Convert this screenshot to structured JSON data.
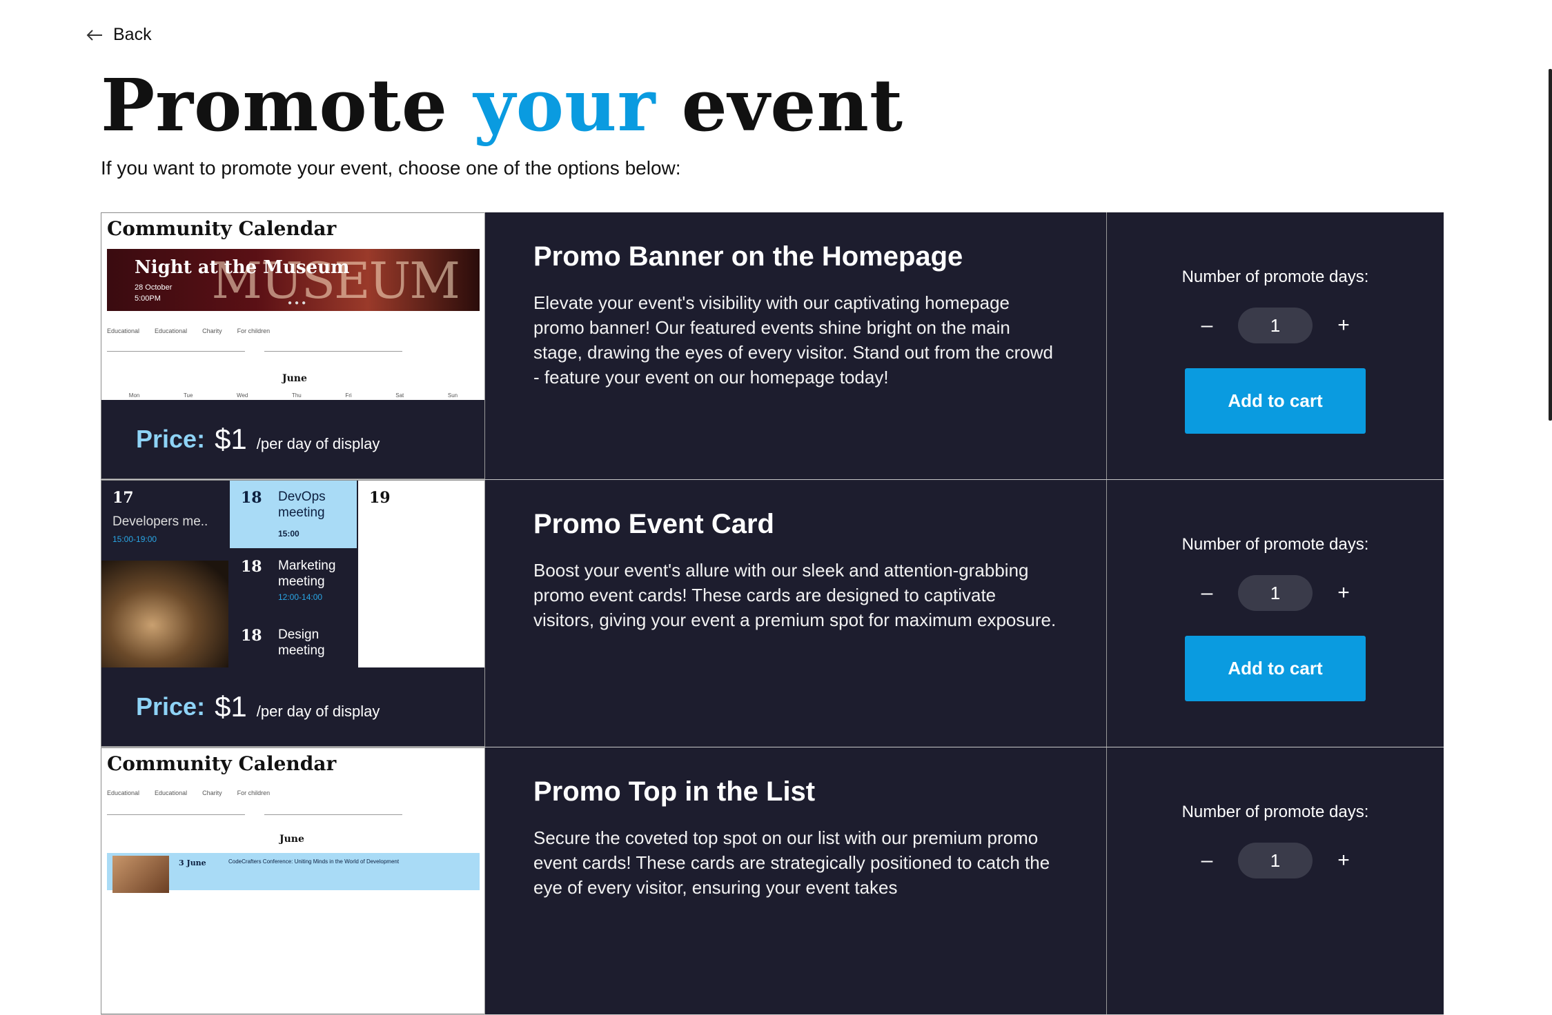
{
  "nav": {
    "back_label": "Back"
  },
  "header": {
    "title_part1": "Promote",
    "title_accent": "your",
    "title_part2": "event",
    "subtitle": "If you want to promote your event, choose one of the options below:"
  },
  "colors": {
    "accent": "#0a9be0",
    "panel": "#1d1d2e",
    "price_label": "#8ed3f6"
  },
  "promos": [
    {
      "title": "Promo Banner on the Homepage",
      "description": "Elevate your event's visibility with our captivating homepage promo banner! Our featured events shine bright on the main stage, drawing the eyes of every visitor. Stand out from the crowd - feature your event on our homepage today!",
      "price_label": "Price:",
      "price": "$1",
      "price_unit": "/per day of display",
      "days_label": "Number of promote days:",
      "minus": "–",
      "plus": "+",
      "qty": "1",
      "cart_label": "Add to cart",
      "preview": {
        "heading": "Community Calendar",
        "banner_title": "Night at the Museum",
        "banner_big": "MUSEUM",
        "banner_date": "28 October",
        "banner_time": "5:00PM",
        "filters": [
          "Educational",
          "Educational",
          "Charity",
          "For children"
        ],
        "month": "June",
        "weekdays": [
          "Mon",
          "Tue",
          "Wed",
          "Thu",
          "Fri",
          "Sat",
          "Sun"
        ]
      }
    },
    {
      "title": "Promo Event Card",
      "description": "Boost your event's allure with our sleek and attention-grabbing promo event cards! These cards are designed to captivate visitors, giving your event a premium spot for maximum exposure.",
      "price_label": "Price:",
      "price": "$1",
      "price_unit": "/per day of display",
      "days_label": "Number of promote days:",
      "minus": "–",
      "plus": "+",
      "qty": "1",
      "cart_label": "Add to cart",
      "preview": {
        "day1": "17",
        "day1_event": "Developers me..",
        "day1_time": "15:00-19:00",
        "day2": "18",
        "day2_event": "DevOps meeting",
        "day2_time": "15:00",
        "day3": "19",
        "day4": "18",
        "day4_event": "Marketing meeting",
        "day4_time": "12:00-14:00",
        "day5": "18",
        "day5_event": "Design meeting"
      }
    },
    {
      "title": "Promo Top in the List",
      "description": "Secure the coveted top spot on our list with our premium promo event cards! These cards are strategically positioned to catch the eye of every visitor, ensuring your event takes",
      "days_label": "Number of promote days:",
      "minus": "–",
      "plus": "+",
      "qty": "1",
      "preview": {
        "heading": "Community Calendar",
        "filters": [
          "Educational",
          "Educational",
          "Charity",
          "For children"
        ],
        "month": "June",
        "list_date": "3 June",
        "list_title": "CodeCrafters Conference: Uniting Minds in the World of Development"
      }
    }
  ]
}
